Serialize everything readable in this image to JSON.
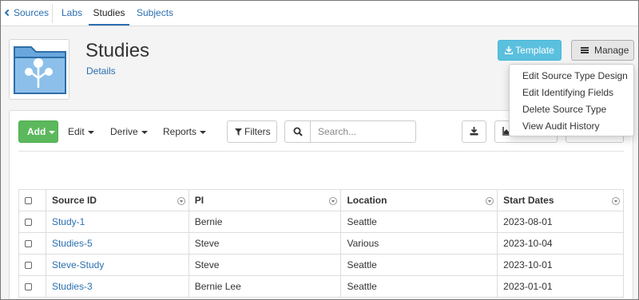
{
  "nav": {
    "back_label": "Sources",
    "tabs": [
      {
        "label": "Labs"
      },
      {
        "label": "Studies"
      },
      {
        "label": "Subjects"
      }
    ]
  },
  "header": {
    "title": "Studies",
    "details_link": "Details"
  },
  "actions": {
    "template_label": "Template",
    "manage_label": "Manage"
  },
  "manage_menu": {
    "items": [
      "Edit Source Type Design",
      "Edit Identifying Fields",
      "Delete Source Type",
      "View Audit History"
    ]
  },
  "toolbar": {
    "add_label": "Add",
    "edit_label": "Edit",
    "derive_label": "Derive",
    "reports_label": "Reports",
    "filters_label": "Filters",
    "search_placeholder": "Search..."
  },
  "table": {
    "columns": [
      "Source ID",
      "PI",
      "Location",
      "Start Dates"
    ],
    "rows": [
      [
        "Study-1",
        "Bernie",
        "Seattle",
        "2023-08-01"
      ],
      [
        "Studies-5",
        "Steve",
        "Various",
        "2023-10-04"
      ],
      [
        "Steve-Study",
        "Steve",
        "Seattle",
        "2023-10-01"
      ],
      [
        "Studies-3",
        "Bernie Lee",
        "Seattle",
        "2023-01-01"
      ]
    ]
  },
  "colors": {
    "link": "#2a6fb0",
    "add_button": "#5cb85c",
    "template_button": "#5bc0de",
    "folder": "#5b9bd5"
  },
  "icons": {
    "folder": "study-folder-icon",
    "download": "download-icon",
    "bars": "bars-icon",
    "filter": "filter-icon",
    "search": "search-icon",
    "export": "export-icon",
    "chart": "chart-icon"
  }
}
